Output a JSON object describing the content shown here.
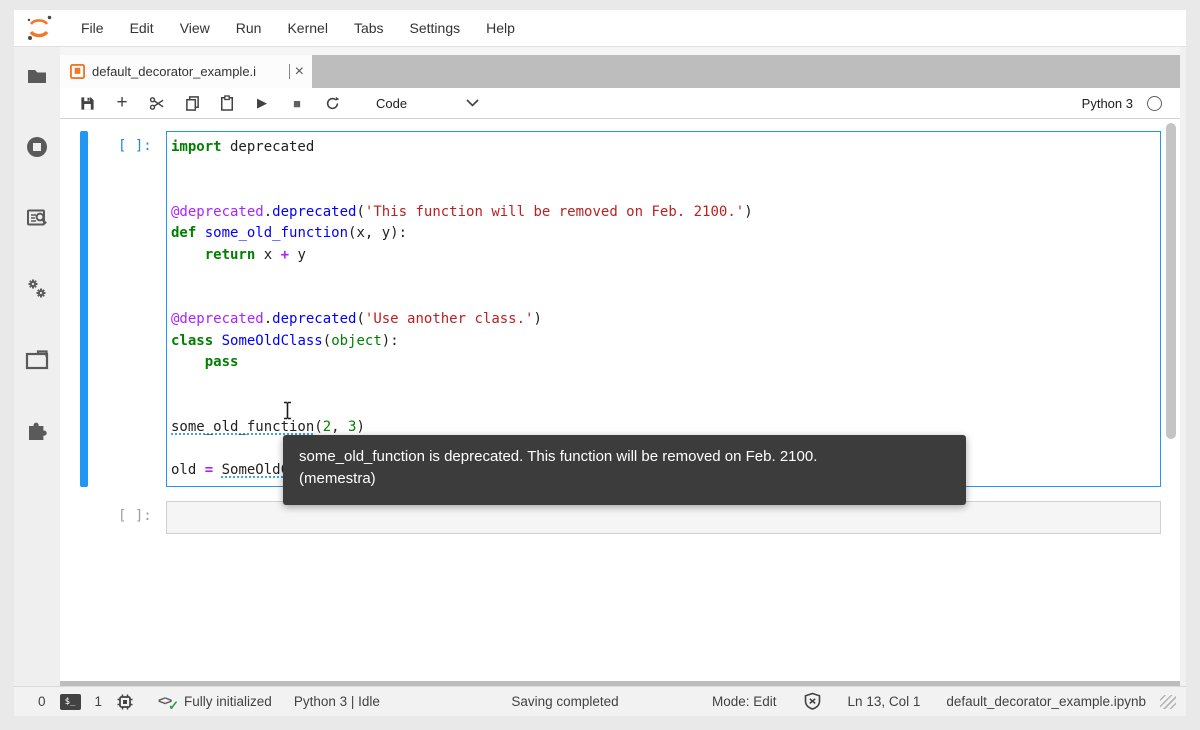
{
  "menu": {
    "items": [
      "File",
      "Edit",
      "View",
      "Run",
      "Kernel",
      "Tabs",
      "Settings",
      "Help"
    ]
  },
  "tab": {
    "title": "default_decorator_example.i",
    "close_glyph": "×"
  },
  "toolbar": {
    "buttons": [
      "save",
      "insert-cell",
      "cut",
      "copy",
      "paste",
      "run",
      "interrupt",
      "restart"
    ],
    "run_glyph": "▶",
    "stop_glyph": "■",
    "cell_type": "Code",
    "kernel_name": "Python 3"
  },
  "sidebar": {
    "items": [
      "file-browser",
      "running-kernels",
      "inspector",
      "gears",
      "open-tabs",
      "extensions"
    ]
  },
  "notebook": {
    "cell1": {
      "prompt": "[ ]:",
      "lines": [
        [
          {
            "t": "import",
            "c": "kw"
          },
          {
            "t": " deprecated",
            "c": "pl"
          }
        ],
        [],
        [],
        [
          {
            "t": "@deprecated",
            "c": "dec"
          },
          {
            "t": ".",
            "c": "pl"
          },
          {
            "t": "deprecated",
            "c": "def"
          },
          {
            "t": "(",
            "c": "pl"
          },
          {
            "t": "'This function will be removed on Feb. 2100.'",
            "c": "str"
          },
          {
            "t": ")",
            "c": "pl"
          }
        ],
        [
          {
            "t": "def",
            "c": "kw"
          },
          {
            "t": " ",
            "c": "pl"
          },
          {
            "t": "some_old_function",
            "c": "def"
          },
          {
            "t": "(x, y):",
            "c": "pl"
          }
        ],
        [
          {
            "t": "    ",
            "c": "pl"
          },
          {
            "t": "return",
            "c": "kw"
          },
          {
            "t": " x ",
            "c": "pl"
          },
          {
            "t": "+",
            "c": "op"
          },
          {
            "t": " y",
            "c": "pl"
          }
        ],
        [],
        [],
        [
          {
            "t": "@deprecated",
            "c": "dec"
          },
          {
            "t": ".",
            "c": "pl"
          },
          {
            "t": "deprecated",
            "c": "def"
          },
          {
            "t": "(",
            "c": "pl"
          },
          {
            "t": "'Use another class.'",
            "c": "str"
          },
          {
            "t": ")",
            "c": "pl"
          }
        ],
        [
          {
            "t": "class",
            "c": "kw"
          },
          {
            "t": " ",
            "c": "pl"
          },
          {
            "t": "SomeOldClass",
            "c": "def"
          },
          {
            "t": "(",
            "c": "pl"
          },
          {
            "t": "object",
            "c": "bi"
          },
          {
            "t": "):",
            "c": "pl"
          }
        ],
        [
          {
            "t": "    ",
            "c": "pl"
          },
          {
            "t": "pass",
            "c": "kw"
          }
        ],
        [],
        [],
        [
          {
            "t": "some_old_function",
            "c": "pl",
            "u": true
          },
          {
            "t": "(",
            "c": "pl"
          },
          {
            "t": "2",
            "c": "num"
          },
          {
            "t": ", ",
            "c": "pl"
          },
          {
            "t": "3",
            "c": "num"
          },
          {
            "t": ")",
            "c": "pl"
          }
        ],
        [],
        [
          {
            "t": "old ",
            "c": "pl"
          },
          {
            "t": "=",
            "c": "op"
          },
          {
            "t": " ",
            "c": "pl"
          },
          {
            "t": "SomeOldClass",
            "c": "pl",
            "u": true
          },
          {
            "t": "()",
            "c": "pl"
          }
        ]
      ]
    },
    "cell2": {
      "prompt": "[ ]:"
    }
  },
  "tooltip": {
    "line1": "some_old_function is deprecated. This function will be removed on Feb. 2100.",
    "line2": "(memestra)"
  },
  "statusbar": {
    "terminals_count": "0",
    "terminal_badge": "$_",
    "kernels_count": "1",
    "lsp_status": "Fully initialized",
    "kernel_status": "Python 3 | Idle",
    "saving_status": "Saving completed",
    "mode": "Mode: Edit",
    "cursor_position": "Ln 13, Col 1",
    "filename": "default_decorator_example.ipynb"
  },
  "colors": {
    "accent_blue": "#2196f3",
    "brand_orange": "#f37726",
    "tooltip_bg": "#3c3c3c",
    "keyword_green": "#008000",
    "decorator_purple": "#aa22ff",
    "string_red": "#ba2121",
    "def_blue": "#0000ff",
    "diagnostic_underline": "#3fa7d6"
  }
}
